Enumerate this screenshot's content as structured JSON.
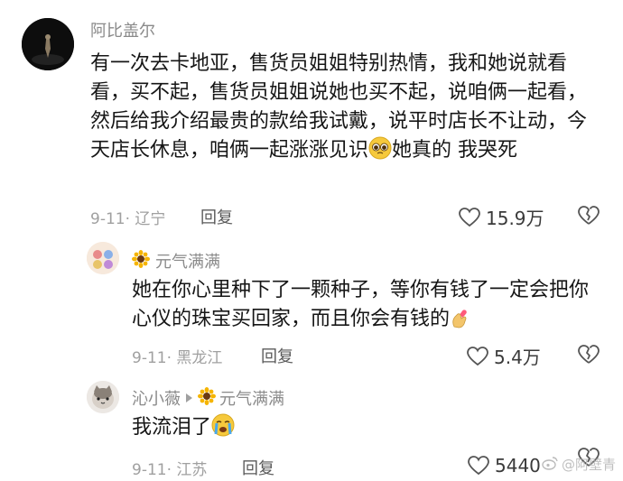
{
  "comments": [
    {
      "username": "阿比盖尔",
      "content_parts": [
        "有一次去卡地亚，售货员姐姐特别热情，我和她说就看看，买不起，售货员姐姐说她也买不起，说咱俩一起看，然后给我介绍最贵的款给我试戴，说平时店长不让动，今天店长休息，咱俩一起涨涨见识",
        "她真的 我哭死"
      ],
      "date": "9-11",
      "location": "辽宁",
      "reply_label": "回复",
      "likes": "15.9万",
      "avatar_icon": "dark-figure-avatar"
    },
    {
      "username": "元气满满",
      "username_icon": "sunflower-icon",
      "content": "她在你心里种下了一颗种子，等你有钱了一定会把你心仪的珠宝买回家，而且你会有钱的",
      "content_icon": "finger-heart-icon",
      "date": "9-11",
      "location": "黑龙江",
      "reply_label": "回复",
      "likes": "5.4万",
      "avatar_icon": "cartoon-avatar"
    },
    {
      "username": "沁小薇",
      "reply_to": "元气满满",
      "reply_to_icon": "sunflower-icon",
      "content": "我流泪了",
      "content_icon": "crying-face-icon",
      "date": "9-11",
      "location": "江苏",
      "reply_label": "回复",
      "likes": "5440",
      "avatar_icon": "cat-avatar"
    }
  ],
  "watermark": "@阿壁青",
  "colors": {
    "text": "#161616",
    "meta": "#a0a0a0",
    "username": "#8a8a8a"
  }
}
